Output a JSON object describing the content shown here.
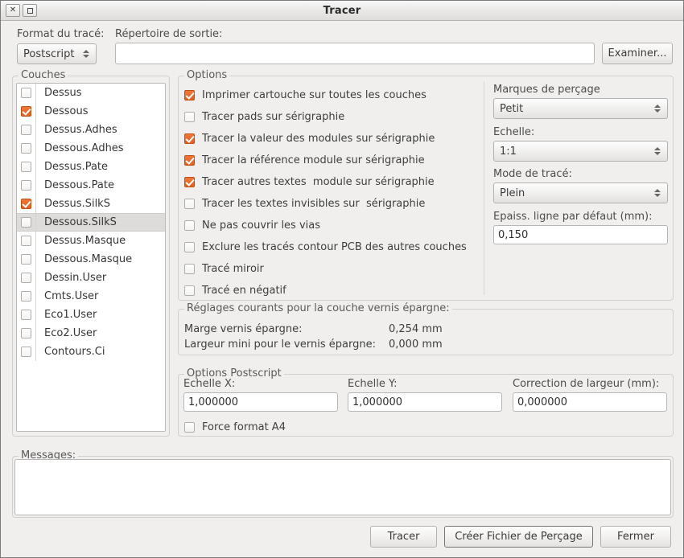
{
  "window": {
    "title": "Tracer",
    "close_icon": "close-icon",
    "maximize_icon": "maximize-icon"
  },
  "top": {
    "format_label": "Format du tracé:",
    "format_value": "Postscript",
    "output_dir_label": "Répertoire de sortie:",
    "output_dir_value": "",
    "browse_label": "Examiner..."
  },
  "layers": {
    "group_title": "Couches",
    "items": [
      {
        "label": "Dessus",
        "checked": false,
        "selected": false
      },
      {
        "label": "Dessous",
        "checked": true,
        "selected": false
      },
      {
        "label": "Dessus.Adhes",
        "checked": false,
        "selected": false
      },
      {
        "label": "Dessous.Adhes",
        "checked": false,
        "selected": false
      },
      {
        "label": "Dessus.Pate",
        "checked": false,
        "selected": false
      },
      {
        "label": "Dessous.Pate",
        "checked": false,
        "selected": false
      },
      {
        "label": "Dessus.SilkS",
        "checked": true,
        "selected": false
      },
      {
        "label": "Dessous.SilkS",
        "checked": false,
        "selected": true
      },
      {
        "label": "Dessus.Masque",
        "checked": false,
        "selected": false
      },
      {
        "label": "Dessous.Masque",
        "checked": false,
        "selected": false
      },
      {
        "label": "Dessin.User",
        "checked": false,
        "selected": false
      },
      {
        "label": "Cmts.User",
        "checked": false,
        "selected": false
      },
      {
        "label": "Eco1.User",
        "checked": false,
        "selected": false
      },
      {
        "label": "Eco2.User",
        "checked": false,
        "selected": false
      },
      {
        "label": "Contours.Ci",
        "checked": false,
        "selected": false
      }
    ]
  },
  "options": {
    "group_title": "Options",
    "items": [
      {
        "label": "Imprimer cartouche sur toutes les couches",
        "checked": true
      },
      {
        "label": "Tracer pads sur sérigraphie",
        "checked": false
      },
      {
        "label": "Tracer la valeur des modules sur sérigraphie",
        "checked": true
      },
      {
        "label": "Tracer la référence module sur sérigraphie",
        "checked": true
      },
      {
        "label": "Tracer autres textes  module sur sérigraphie",
        "checked": true
      },
      {
        "label": "Tracer les textes invisibles sur  sérigraphie",
        "checked": false
      },
      {
        "label": "Ne pas couvrir les vias",
        "checked": false
      },
      {
        "label": "Exclure les tracés contour PCB des autres couches",
        "checked": false
      },
      {
        "label": "Tracé miroir",
        "checked": false
      },
      {
        "label": "Tracé en négatif",
        "checked": false
      }
    ]
  },
  "right_column": {
    "drill_label": "Marques de perçage",
    "drill_value": "Petit",
    "scale_label": "Echelle:",
    "scale_value": "1:1",
    "plot_mode_label": "Mode de tracé:",
    "plot_mode_value": "Plein",
    "line_width_label": "Epaiss. ligne par défaut (mm):",
    "line_width_value": "0,150"
  },
  "solder_mask": {
    "group_title": "Réglages courants pour la couche vernis épargne:",
    "rows": [
      {
        "label": "Marge vernis épargne:",
        "value": "0,254 mm"
      },
      {
        "label": "Largeur mini pour le vernis épargne:",
        "value": "0,000 mm"
      }
    ]
  },
  "postscript": {
    "group_title": "Options Postscript",
    "scale_x_label": "Echelle X:",
    "scale_x_value": "1,000000",
    "scale_y_label": "Echelle Y:",
    "scale_y_value": "1,000000",
    "width_corr_label": "Correction de largeur (mm):",
    "width_corr_value": "0,000000",
    "force_a4_label": "Force format A4",
    "force_a4_checked": false
  },
  "messages": {
    "group_title": "Messages:",
    "content": ""
  },
  "footer": {
    "plot_label": "Tracer",
    "drill_file_label": "Créer Fichier de Perçage",
    "close_label": "Fermer"
  },
  "colors": {
    "accent": "#e3601f",
    "dialog_bg": "#f0efee",
    "field_bg": "#ffffff",
    "selection_bg": "#dedcda"
  }
}
